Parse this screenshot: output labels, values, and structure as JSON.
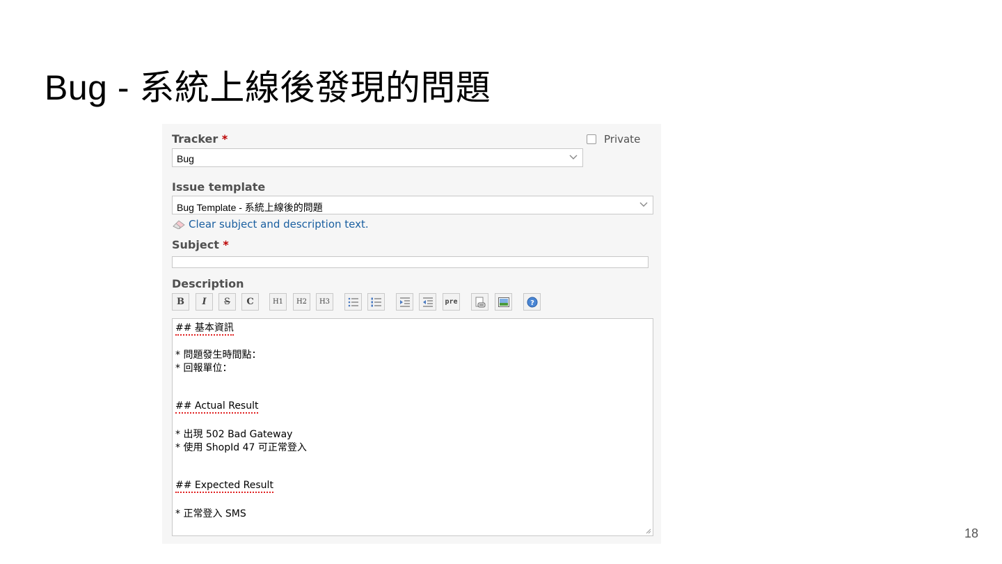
{
  "slide": {
    "title": "Bug - 系統上線後發現的問題",
    "page_number": "18"
  },
  "form": {
    "tracker": {
      "label": "Tracker",
      "required_mark": "*",
      "value": "Bug"
    },
    "private": {
      "label": "Private",
      "checked": false
    },
    "issue_template": {
      "label": "Issue template",
      "value": "Bug Template - 系統上線後的問題"
    },
    "clear_link": "Clear subject and description text.",
    "subject": {
      "label": "Subject",
      "required_mark": "*",
      "value": ""
    },
    "description": {
      "label": "Description",
      "toolbar": [
        {
          "name": "bold",
          "label": "B"
        },
        {
          "name": "italic",
          "label": "I"
        },
        {
          "name": "strikethrough",
          "label": "S"
        },
        {
          "name": "code",
          "label": "C"
        },
        {
          "name": "heading-1",
          "label": "H1"
        },
        {
          "name": "heading-2",
          "label": "H2"
        },
        {
          "name": "heading-3",
          "label": "H3"
        },
        {
          "name": "unordered-list",
          "icon": "bullet-list-icon"
        },
        {
          "name": "ordered-list",
          "icon": "numbered-list-icon"
        },
        {
          "name": "quote",
          "icon": "indent-icon"
        },
        {
          "name": "unquote",
          "icon": "outdent-icon"
        },
        {
          "name": "preformatted",
          "label": "pre"
        },
        {
          "name": "link-to-page",
          "icon": "wiki-link-icon"
        },
        {
          "name": "image",
          "icon": "image-icon"
        },
        {
          "name": "help",
          "icon": "help-icon"
        }
      ],
      "lines": [
        "## 基本資訊",
        "* 問題發生時間點：",
        "* 回報單位：",
        "## Actual Result",
        "* 出現 502 Bad Gateway",
        "* 使用 ShopId 47 可正常登入",
        "## Expected Result",
        "* 正常登入 SMS"
      ]
    }
  },
  "colors": {
    "required": "#bb0000",
    "link": "#1a5fa0",
    "spellcheck_underline": "#e02020"
  }
}
